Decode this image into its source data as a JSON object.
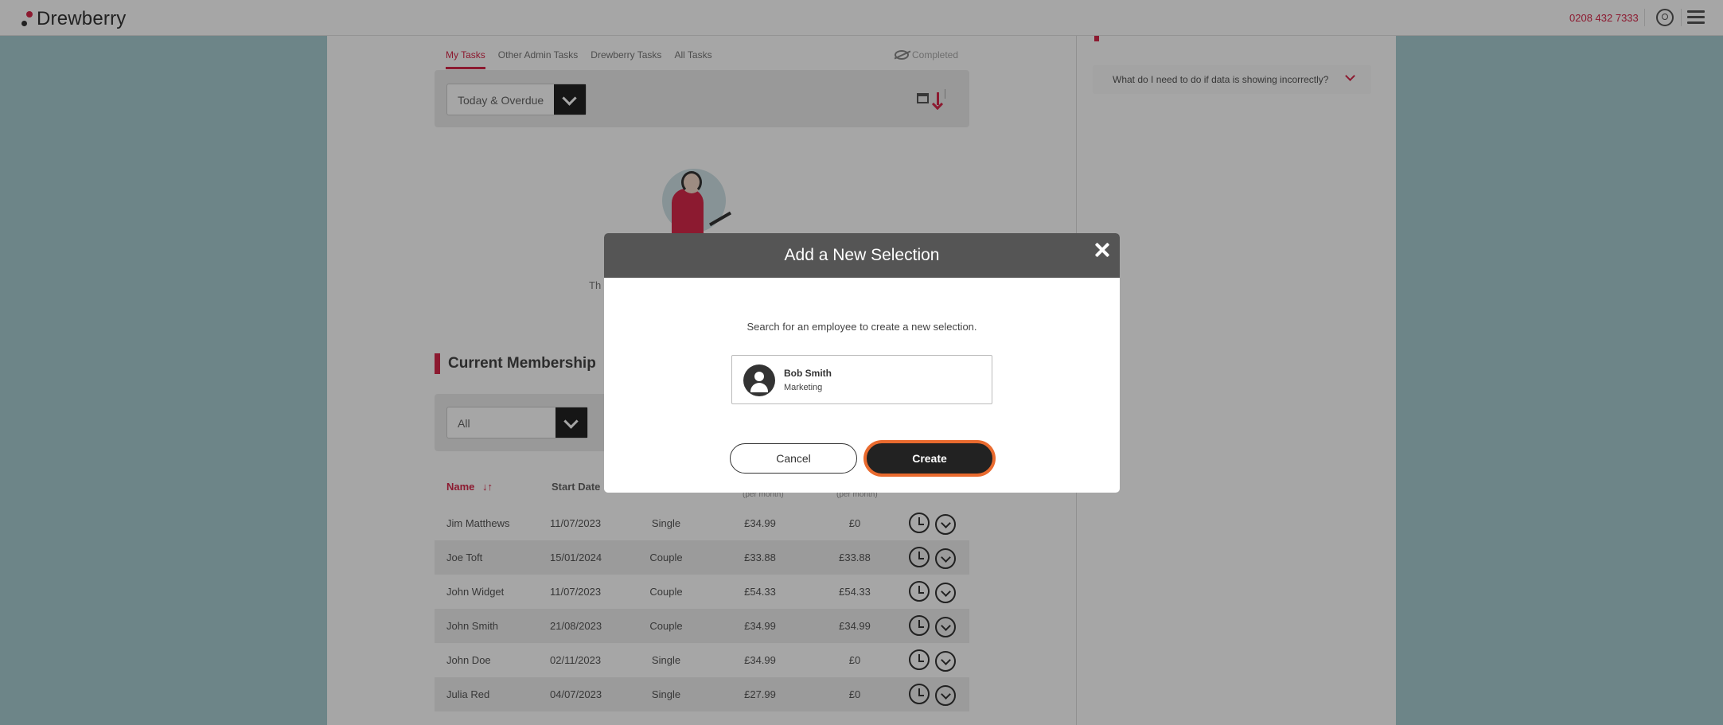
{
  "header": {
    "logo_text": "Drewberry",
    "phone": "0208 432 7333"
  },
  "tasks": {
    "tabs": [
      "My Tasks",
      "Other Admin Tasks",
      "Drewberry Tasks",
      "All Tasks"
    ],
    "completed_label": "Completed",
    "filter_value": "Today & Overdue",
    "empty_text_visible": "Th"
  },
  "membership": {
    "title": "Current Membership",
    "filter_value": "All",
    "columns": {
      "name": "Name",
      "start_date": "Start Date",
      "per_month_1": "(per month)",
      "per_month_2": "(per month)"
    },
    "rows": [
      {
        "name": "Jim Matthews",
        "start_date": "11/07/2023",
        "cover": "Single",
        "cost": "£34.99",
        "employee_cost": "£0"
      },
      {
        "name": "Joe Toft",
        "start_date": "15/01/2024",
        "cover": "Couple",
        "cost": "£33.88",
        "employee_cost": "£33.88"
      },
      {
        "name": "John Widget",
        "start_date": "11/07/2023",
        "cover": "Couple",
        "cost": "£54.33",
        "employee_cost": "£54.33"
      },
      {
        "name": "John Smith",
        "start_date": "21/08/2023",
        "cover": "Couple",
        "cost": "£34.99",
        "employee_cost": "£34.99"
      },
      {
        "name": "John Doe",
        "start_date": "02/11/2023",
        "cover": "Single",
        "cost": "£34.99",
        "employee_cost": "£0"
      },
      {
        "name": "Julia Red",
        "start_date": "04/07/2023",
        "cover": "Single",
        "cost": "£27.99",
        "employee_cost": "£0"
      }
    ]
  },
  "faq": {
    "question": "What do I need to do if data is showing incorrectly?"
  },
  "modal": {
    "title": "Add a New Selection",
    "instruction": "Search for an employee to create a new selection.",
    "employee": {
      "name": "Bob Smith",
      "department": "Marketing"
    },
    "cancel_label": "Cancel",
    "create_label": "Create"
  },
  "colors": {
    "accent": "#d8284a",
    "create_focus_ring": "#e96a2e",
    "modal_header": "#555555"
  }
}
